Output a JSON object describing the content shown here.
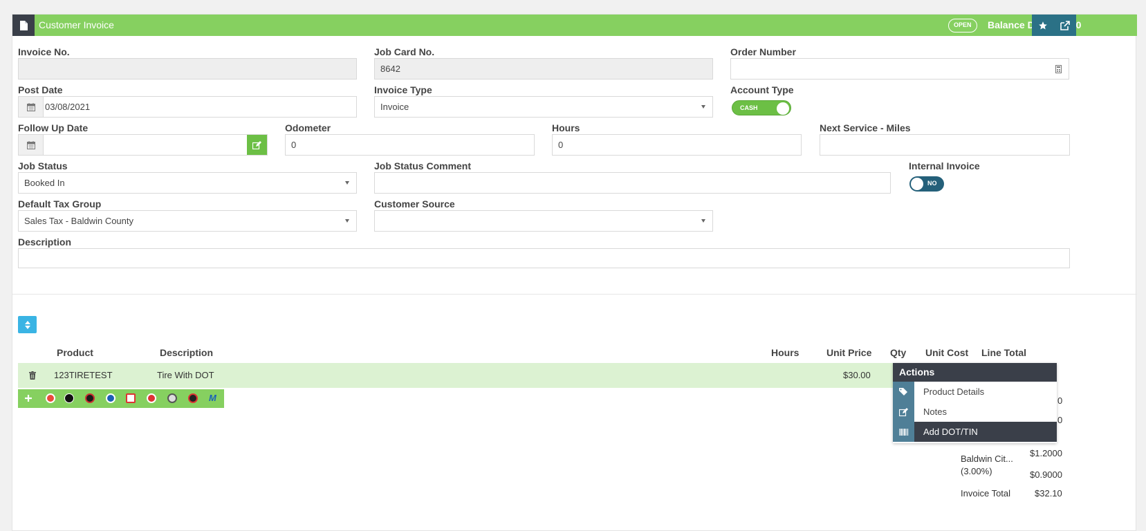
{
  "header": {
    "title": "Customer Invoice",
    "status_badge": "OPEN",
    "balance_due": "Balance Due: $32.10"
  },
  "form": {
    "invoice_no": {
      "label": "Invoice No.",
      "value": ""
    },
    "job_card_no": {
      "label": "Job Card No.",
      "value": "8642"
    },
    "order_number": {
      "label": "Order Number",
      "value": ""
    },
    "post_date": {
      "label": "Post Date",
      "value": "03/08/2021"
    },
    "invoice_type": {
      "label": "Invoice Type",
      "value": "Invoice"
    },
    "account_type": {
      "label": "Account Type",
      "toggle_text": "CASH"
    },
    "follow_up_date": {
      "label": "Follow Up Date",
      "value": ""
    },
    "odometer": {
      "label": "Odometer",
      "value": "0"
    },
    "hours": {
      "label": "Hours",
      "value": "0"
    },
    "next_service_miles": {
      "label": "Next Service - Miles",
      "value": ""
    },
    "job_status": {
      "label": "Job Status",
      "value": "Booked In"
    },
    "job_status_comment": {
      "label": "Job Status Comment",
      "value": ""
    },
    "internal_invoice": {
      "label": "Internal Invoice",
      "toggle_text": "NO"
    },
    "default_tax_group": {
      "label": "Default Tax Group",
      "value": "Sales Tax - Baldwin County"
    },
    "customer_source": {
      "label": "Customer Source",
      "value": ""
    },
    "description": {
      "label": "Description",
      "value": ""
    }
  },
  "table": {
    "columns": [
      "Product",
      "Description",
      "Hours",
      "Unit Price",
      "Qty",
      "Unit Cost",
      "Line Total"
    ],
    "rows": [
      {
        "product": "123TIRETEST",
        "description": "Tire With DOT",
        "unit_price": "$30.00"
      }
    ]
  },
  "actions_menu": {
    "title": "Actions",
    "items": [
      {
        "label": "Product Details",
        "icon": "tags-icon"
      },
      {
        "label": "Notes",
        "icon": "edit-icon"
      },
      {
        "label": "Add DOT/TIN",
        "icon": "barcode-icon"
      }
    ]
  },
  "totals": {
    "partial_1": "0",
    "partial_2": "0",
    "tax_name": "Baldwin Cit...",
    "tax_rate": "(3.00%)",
    "tax_amount_1": "$1.2000",
    "tax_amount_2": "$0.9000",
    "invoice_total_label": "Invoice Total",
    "invoice_total_value": "$32.10"
  },
  "colors": {
    "header_green": "#86d060",
    "dark": "#3a3f49",
    "teal": "#2b7186",
    "row_highlight": "#dcf2d2",
    "sort_blue": "#3ab4e4",
    "toggle_off": "#24607a"
  }
}
